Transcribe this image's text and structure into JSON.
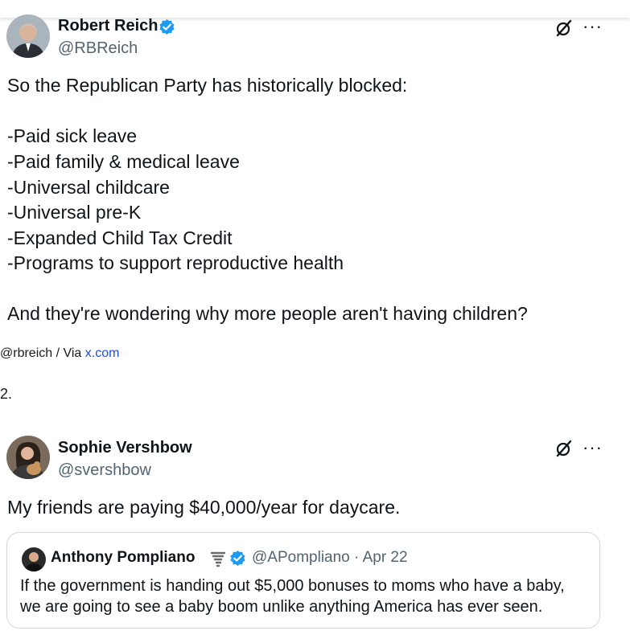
{
  "tweet1": {
    "author_name": "Robert Reich",
    "handle": "@RBReich",
    "lines": [
      "So the Republican Party has historically blocked:",
      "-Paid sick leave",
      "-Paid family & medical leave",
      "-Universal childcare",
      "-Universal pre-K",
      "-Expanded Child Tax Credit",
      "-Programs to support reproductive health",
      "And they're wondering why more people aren't having children?"
    ],
    "more_label": "···"
  },
  "credit": {
    "prefix": "@rbreich / Via ",
    "link": "x.com"
  },
  "item_number": "2.",
  "tweet2": {
    "author_name": "Sophie Vershbow",
    "handle": "@svershbow",
    "text": "My friends are paying $40,000/year for daycare.",
    "more_label": "···"
  },
  "quoted": {
    "author_name": "Anthony Pompliano",
    "handle_date": "@APompliano · Apr 22",
    "lines": [
      "If the government is handing out $5,000 bonuses to moms who have a baby,",
      "we are going to see a baby boom unlike anything America has ever seen."
    ]
  },
  "colors": {
    "verified": "#1d9bf0",
    "link": "#1d4ed8",
    "secondary": "#536471"
  },
  "icons": [
    "verified-icon",
    "grok-icon",
    "more-icon",
    "tornado-icon"
  ]
}
